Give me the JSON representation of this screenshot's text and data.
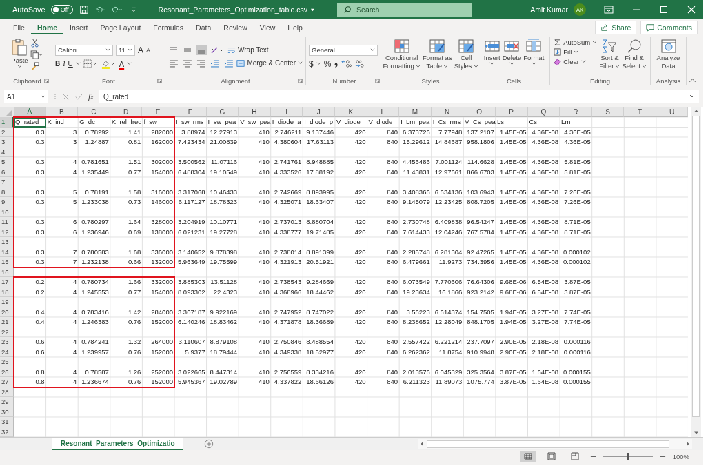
{
  "title_bar": {
    "autosave_label": "AutoSave",
    "autosave": {
      "on": false,
      "label": "Off"
    },
    "file_name": "Resonant_Parameters_Optimization_table.csv",
    "search_placeholder": "Search",
    "user_name": "Amit Kumar",
    "user_initials": "AK"
  },
  "menu_tabs": [
    {
      "label": "File",
      "selected": false
    },
    {
      "label": "Home",
      "selected": true
    },
    {
      "label": "Insert",
      "selected": false
    },
    {
      "label": "Page Layout",
      "selected": false
    },
    {
      "label": "Formulas",
      "selected": false
    },
    {
      "label": "Data",
      "selected": false
    },
    {
      "label": "Review",
      "selected": false
    },
    {
      "label": "View",
      "selected": false
    },
    {
      "label": "Help",
      "selected": false
    }
  ],
  "share_label": "Share",
  "comments_label": "Comments",
  "ribbon": {
    "clipboard": {
      "label": "Clipboard",
      "paste": "Paste"
    },
    "font": {
      "label": "Font",
      "name": "Calibri",
      "size": "11",
      "grow": "A",
      "shrink": "A",
      "bold": "B",
      "italic": "I",
      "underline": "U",
      "font_color": "A"
    },
    "alignment": {
      "label": "Alignment",
      "wrap": "Wrap Text",
      "merge": "Merge & Center"
    },
    "number": {
      "label": "Number",
      "format": "General",
      "currency": "$",
      "percent": "%"
    },
    "styles": {
      "label": "Styles",
      "buttons": [
        [
          "Conditional",
          "Formatting"
        ],
        [
          "Format as",
          "Table"
        ],
        [
          "Cell",
          "Styles"
        ]
      ]
    },
    "cells": {
      "label": "Cells",
      "buttons": [
        "Insert",
        "Delete",
        "Format"
      ]
    },
    "editing": {
      "label": "Editing",
      "autosum": "AutoSum",
      "fill": "Fill",
      "clear": "Clear",
      "sort": [
        "Sort &",
        "Filter"
      ],
      "find": [
        "Find &",
        "Select"
      ]
    },
    "analysis": {
      "label": "Analysis",
      "analyze": [
        "Analyze",
        "Data"
      ]
    }
  },
  "formula_bar": {
    "name_box": "A1",
    "fx": "fx",
    "value": "Q_rated"
  },
  "columns": [
    {
      "label": "A",
      "selected": true,
      "framed": true
    },
    {
      "label": "B",
      "selected": false,
      "framed": true
    },
    {
      "label": "C",
      "selected": false,
      "framed": true
    },
    {
      "label": "D",
      "selected": false,
      "framed": true
    },
    {
      "label": "E",
      "selected": false,
      "framed": true
    },
    {
      "label": "F",
      "selected": false,
      "framed": false
    },
    {
      "label": "G",
      "selected": false,
      "framed": false
    },
    {
      "label": "H",
      "selected": false,
      "framed": false
    },
    {
      "label": "I",
      "selected": false,
      "framed": false
    },
    {
      "label": "J",
      "selected": false,
      "framed": false
    },
    {
      "label": "K",
      "selected": false,
      "framed": false
    },
    {
      "label": "L",
      "selected": false,
      "framed": false
    },
    {
      "label": "M",
      "selected": false,
      "framed": false
    },
    {
      "label": "N",
      "selected": false,
      "framed": false
    },
    {
      "label": "O",
      "selected": false,
      "framed": false
    },
    {
      "label": "P",
      "selected": false,
      "framed": false
    },
    {
      "label": "Q",
      "selected": false,
      "framed": false
    },
    {
      "label": "R",
      "selected": false,
      "framed": false
    },
    {
      "label": "S",
      "selected": false,
      "framed": false
    },
    {
      "label": "T",
      "selected": false,
      "framed": false
    },
    {
      "label": "U",
      "selected": false,
      "framed": false
    }
  ],
  "rows": [
    {
      "number": "1",
      "selected": true,
      "framed": true,
      "kind": "text",
      "cells": [
        "Q_rated",
        "K_ind",
        "G_dc",
        "K_rel_frec",
        "f_sw",
        "I_sw_rms",
        "I_sw_pea",
        "V_sw_pea",
        "I_diode_a",
        "I_diode_p",
        "V_diode_",
        "V_diode_",
        "I_Lm_pea",
        "I_Cs_rms",
        "V_Cs_pea",
        "Ls",
        "Cs",
        "Lm"
      ]
    },
    {
      "number": "2",
      "selected": false,
      "framed": true,
      "kind": "number",
      "cells": [
        "0.3",
        "3",
        "0.78292",
        "1.41",
        "282000",
        "3.88974",
        "12.27913",
        "410",
        "2.746211",
        "9.137446",
        "420",
        "840",
        "6.373726",
        "7.77948",
        "137.2107",
        "1.45E-05",
        "4.36E-08",
        "4.36E-05"
      ]
    },
    {
      "number": "3",
      "selected": false,
      "framed": true,
      "kind": "number",
      "cells": [
        "0.3",
        "3",
        "1.24887",
        "0.81",
        "162000",
        "7.423434",
        "21.00839",
        "410",
        "4.380604",
        "17.63113",
        "420",
        "840",
        "15.29612",
        "14.84687",
        "958.1806",
        "1.45E-05",
        "4.36E-08",
        "4.36E-05"
      ]
    },
    {
      "number": "4",
      "selected": false,
      "framed": true,
      "kind": "empty"
    },
    {
      "number": "5",
      "selected": false,
      "framed": true,
      "kind": "number",
      "cells": [
        "0.3",
        "4",
        "0.781651",
        "1.51",
        "302000",
        "3.500562",
        "11.07116",
        "410",
        "2.741761",
        "8.948885",
        "420",
        "840",
        "4.456486",
        "7.001124",
        "114.6628",
        "1.45E-05",
        "4.36E-08",
        "5.81E-05"
      ]
    },
    {
      "number": "6",
      "selected": false,
      "framed": true,
      "kind": "number",
      "cells": [
        "0.3",
        "4",
        "1.235449",
        "0.77",
        "154000",
        "6.488304",
        "19.10549",
        "410",
        "4.333526",
        "17.88192",
        "420",
        "840",
        "11.43831",
        "12.97661",
        "866.6703",
        "1.45E-05",
        "4.36E-08",
        "5.81E-05"
      ]
    },
    {
      "number": "7",
      "selected": false,
      "framed": true,
      "kind": "empty"
    },
    {
      "number": "8",
      "selected": false,
      "framed": true,
      "kind": "number",
      "cells": [
        "0.3",
        "5",
        "0.78191",
        "1.58",
        "316000",
        "3.317068",
        "10.46433",
        "410",
        "2.742669",
        "8.893995",
        "420",
        "840",
        "3.408366",
        "6.634136",
        "103.6943",
        "1.45E-05",
        "4.36E-08",
        "7.26E-05"
      ]
    },
    {
      "number": "9",
      "selected": false,
      "framed": true,
      "kind": "number",
      "cells": [
        "0.3",
        "5",
        "1.233038",
        "0.73",
        "146000",
        "6.117127",
        "18.78323",
        "410",
        "4.325071",
        "18.63407",
        "420",
        "840",
        "9.145079",
        "12.23425",
        "808.7205",
        "1.45E-05",
        "4.36E-08",
        "7.26E-05"
      ]
    },
    {
      "number": "10",
      "selected": false,
      "framed": true,
      "kind": "empty"
    },
    {
      "number": "11",
      "selected": false,
      "framed": true,
      "kind": "number",
      "cells": [
        "0.3",
        "6",
        "0.780297",
        "1.64",
        "328000",
        "3.204919",
        "10.10771",
        "410",
        "2.737013",
        "8.880704",
        "420",
        "840",
        "2.730748",
        "6.409838",
        "96.54247",
        "1.45E-05",
        "4.36E-08",
        "8.71E-05"
      ]
    },
    {
      "number": "12",
      "selected": false,
      "framed": true,
      "kind": "number",
      "cells": [
        "0.3",
        "6",
        "1.236946",
        "0.69",
        "138000",
        "6.021231",
        "19.27728",
        "410",
        "4.338777",
        "19.71485",
        "420",
        "840",
        "7.614433",
        "12.04246",
        "767.5784",
        "1.45E-05",
        "4.36E-08",
        "8.71E-05"
      ]
    },
    {
      "number": "13",
      "selected": false,
      "framed": true,
      "kind": "empty"
    },
    {
      "number": "14",
      "selected": false,
      "framed": true,
      "kind": "number",
      "cells": [
        "0.3",
        "7",
        "0.780583",
        "1.68",
        "336000",
        "3.140652",
        "9.878398",
        "410",
        "2.738014",
        "8.891399",
        "420",
        "840",
        "2.285748",
        "6.281304",
        "92.47265",
        "1.45E-05",
        "4.36E-08",
        "0.000102"
      ]
    },
    {
      "number": "15",
      "selected": false,
      "framed": true,
      "kind": "number",
      "cells": [
        "0.3",
        "7",
        "1.232138",
        "0.66",
        "132000",
        "5.963649",
        "19.75599",
        "410",
        "4.321913",
        "20.51921",
        "420",
        "840",
        "6.479661",
        "11.9273",
        "734.3956",
        "1.45E-05",
        "4.36E-08",
        "0.000102"
      ]
    },
    {
      "number": "16",
      "selected": false,
      "framed": false,
      "kind": "empty"
    },
    {
      "number": "17",
      "selected": false,
      "framed": true,
      "kind": "number",
      "cells": [
        "0.2",
        "4",
        "0.780734",
        "1.66",
        "332000",
        "3.885303",
        "13.51128",
        "410",
        "2.738543",
        "9.284669",
        "420",
        "840",
        "6.073549",
        "7.770606",
        "76.64306",
        "9.68E-06",
        "6.54E-08",
        "3.87E-05"
      ]
    },
    {
      "number": "18",
      "selected": false,
      "framed": true,
      "kind": "number",
      "cells": [
        "0.2",
        "4",
        "1.245553",
        "0.77",
        "154000",
        "8.093302",
        "22.4323",
        "410",
        "4.368966",
        "18.44462",
        "420",
        "840",
        "19.23634",
        "16.1866",
        "923.2142",
        "9.68E-06",
        "6.54E-08",
        "3.87E-05"
      ]
    },
    {
      "number": "19",
      "selected": false,
      "framed": true,
      "kind": "empty"
    },
    {
      "number": "20",
      "selected": false,
      "framed": true,
      "kind": "number",
      "cells": [
        "0.4",
        "4",
        "0.783416",
        "1.42",
        "284000",
        "3.307187",
        "9.922169",
        "410",
        "2.747952",
        "8.747022",
        "420",
        "840",
        "3.56223",
        "6.614374",
        "154.7505",
        "1.94E-05",
        "3.27E-08",
        "7.74E-05"
      ]
    },
    {
      "number": "21",
      "selected": false,
      "framed": true,
      "kind": "number",
      "cells": [
        "0.4",
        "4",
        "1.246383",
        "0.76",
        "152000",
        "6.140246",
        "18.83462",
        "410",
        "4.371878",
        "18.36689",
        "420",
        "840",
        "8.238652",
        "12.28049",
        "848.1705",
        "1.94E-05",
        "3.27E-08",
        "7.74E-05"
      ]
    },
    {
      "number": "22",
      "selected": false,
      "framed": true,
      "kind": "empty"
    },
    {
      "number": "23",
      "selected": false,
      "framed": true,
      "kind": "number",
      "cells": [
        "0.6",
        "4",
        "0.784241",
        "1.32",
        "264000",
        "3.110607",
        "8.879108",
        "410",
        "2.750846",
        "8.488554",
        "420",
        "840",
        "2.557422",
        "6.221214",
        "237.7097",
        "2.90E-05",
        "2.18E-08",
        "0.000116"
      ]
    },
    {
      "number": "24",
      "selected": false,
      "framed": true,
      "kind": "number",
      "cells": [
        "0.6",
        "4",
        "1.239957",
        "0.76",
        "152000",
        "5.9377",
        "18.79444",
        "410",
        "4.349338",
        "18.52977",
        "420",
        "840",
        "6.262362",
        "11.8754",
        "910.9948",
        "2.90E-05",
        "2.18E-08",
        "0.000116"
      ]
    },
    {
      "number": "25",
      "selected": false,
      "framed": true,
      "kind": "empty"
    },
    {
      "number": "26",
      "selected": false,
      "framed": true,
      "kind": "number",
      "cells": [
        "0.8",
        "4",
        "0.78587",
        "1.26",
        "252000",
        "3.022665",
        "8.447314",
        "410",
        "2.756559",
        "8.334216",
        "420",
        "840",
        "2.013576",
        "6.045329",
        "325.3564",
        "3.87E-05",
        "1.64E-08",
        "0.000155"
      ]
    },
    {
      "number": "27",
      "selected": false,
      "framed": true,
      "kind": "number",
      "cells": [
        "0.8",
        "4",
        "1.236674",
        "0.76",
        "152000",
        "5.945367",
        "19.02789",
        "410",
        "4.337822",
        "18.66126",
        "420",
        "840",
        "6.211323",
        "11.89073",
        "1075.774",
        "3.87E-05",
        "1.64E-08",
        "0.000155"
      ]
    },
    {
      "number": "28",
      "selected": false,
      "framed": false,
      "kind": "empty"
    },
    {
      "number": "29",
      "selected": false,
      "framed": false,
      "kind": "empty"
    },
    {
      "number": "30",
      "selected": false,
      "framed": false,
      "kind": "empty"
    },
    {
      "number": "31",
      "selected": false,
      "framed": false,
      "kind": "empty"
    },
    {
      "number": "32",
      "selected": false,
      "framed": false,
      "kind": "empty"
    }
  ],
  "sheet_tabs": [
    {
      "label": "Resonant_Parameters_Optimizatio",
      "selected": true
    }
  ],
  "status_bar": {
    "views": [
      {
        "selected": true
      },
      {
        "selected": false
      },
      {
        "selected": false
      }
    ],
    "zoom": {
      "level": 0.5
    },
    "zoom_label": "100%"
  }
}
